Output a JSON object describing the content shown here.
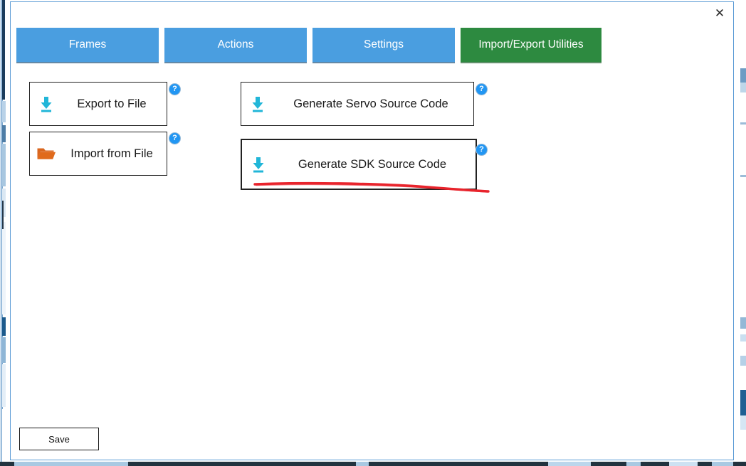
{
  "window": {
    "close_label": "✕"
  },
  "tabs": [
    {
      "label": "Frames",
      "state": "inactive",
      "color": "#4a9ee0"
    },
    {
      "label": "Actions",
      "state": "inactive",
      "color": "#4a9ee0"
    },
    {
      "label": "Settings",
      "state": "inactive",
      "color": "#4a9ee0"
    },
    {
      "label": "Import/Export Utilities",
      "state": "active",
      "color": "#2d8a40"
    }
  ],
  "actions": [
    {
      "label": "Export to File",
      "icon": "download-icon",
      "icon_color": "#21b6d8",
      "help_icon": "help-circle-icon",
      "help_label": "?"
    },
    {
      "label": "Import from File",
      "icon": "folder-open-icon",
      "icon_color": "#d9661f",
      "help_icon": "help-circle-icon",
      "help_label": "?"
    },
    {
      "label": "Generate Servo Source Code",
      "icon": "download-icon",
      "icon_color": "#21b6d8",
      "help_icon": "help-circle-icon",
      "help_label": "?"
    },
    {
      "label": "Generate SDK Source Code",
      "icon": "download-icon",
      "icon_color": "#21b6d8",
      "help_icon": "help-circle-icon",
      "help_label": "?"
    }
  ],
  "annotation": {
    "type": "hand-drawn-underline",
    "color": "#e8242c",
    "targets": "Generate SDK Source Code"
  },
  "footer": {
    "save_label": "Save"
  },
  "colors": {
    "tab_inactive": "#4a9ee0",
    "tab_active": "#2d8a40",
    "dialog_border": "#5b9bd5",
    "download_icon": "#21b6d8",
    "folder_icon": "#d9661f",
    "help_icon": "#2196f3",
    "annotation": "#e8242c"
  }
}
